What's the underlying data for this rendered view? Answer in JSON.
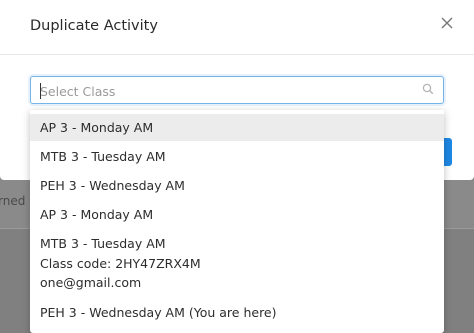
{
  "background": {
    "partial_text": "rned"
  },
  "modal": {
    "title": "Duplicate Activity",
    "close_glyph": "×"
  },
  "select": {
    "placeholder": "Select Class",
    "value": ""
  },
  "dropdown": {
    "options": [
      {
        "lines": [
          "AP 3 - Monday AM"
        ],
        "highlighted": true
      },
      {
        "lines": [
          "MTB 3 - Tuesday AM"
        ],
        "highlighted": false
      },
      {
        "lines": [
          "PEH 3 - Wednesday AM"
        ],
        "highlighted": false
      },
      {
        "lines": [
          "AP 3 - Monday AM"
        ],
        "highlighted": false
      },
      {
        "lines": [
          "MTB 3 - Tuesday AM",
          "Class code: 2HY47ZRX4M",
          "one@gmail.com"
        ],
        "highlighted": false
      },
      {
        "lines": [
          "PEH 3 - Wednesday AM (You are here)"
        ],
        "highlighted": false
      }
    ]
  },
  "colors": {
    "accent": "#1e88e5",
    "focus_border": "#78b4e8",
    "highlight": "#ececec"
  }
}
